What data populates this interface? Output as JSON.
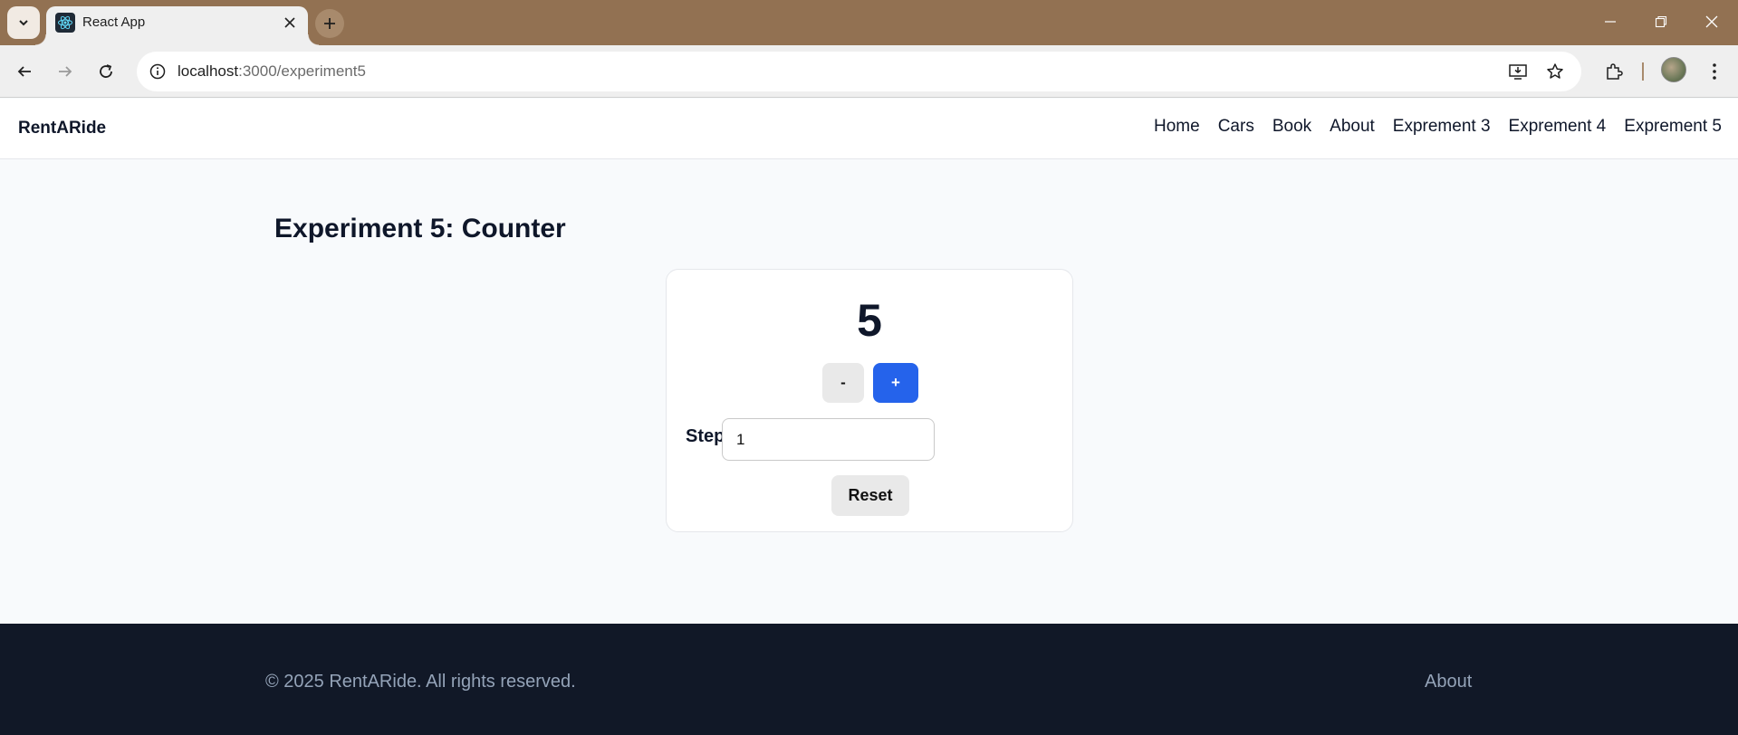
{
  "browser": {
    "tab_title": "React App",
    "url_host": "localhost",
    "url_path": ":3000/experiment5",
    "theme_color": "#927152"
  },
  "navbar": {
    "brand": "RentARide",
    "links": [
      "Home",
      "Cars",
      "Book",
      "About",
      "Exprement 3",
      "Exprement 4",
      "Exprement 5"
    ]
  },
  "main": {
    "title": "Experiment 5: Counter",
    "counter": {
      "value": "5",
      "decrement_label": "-",
      "increment_label": "+",
      "step_label": "Step",
      "step_value": "1",
      "reset_label": "Reset",
      "accent_color": "#2563eb"
    }
  },
  "footer": {
    "copyright": "© 2025 RentARide. All rights reserved.",
    "link": "About",
    "background": "#111827"
  },
  "icons": [
    "tab-list-icon",
    "react-favicon-icon",
    "close-icon",
    "plus-icon",
    "minimize-icon",
    "restore-icon",
    "window-close-icon",
    "back-icon",
    "forward-icon",
    "reload-icon",
    "site-info-icon",
    "install-app-icon",
    "bookmark-star-icon",
    "extensions-icon",
    "profile-avatar",
    "menu-icon"
  ]
}
